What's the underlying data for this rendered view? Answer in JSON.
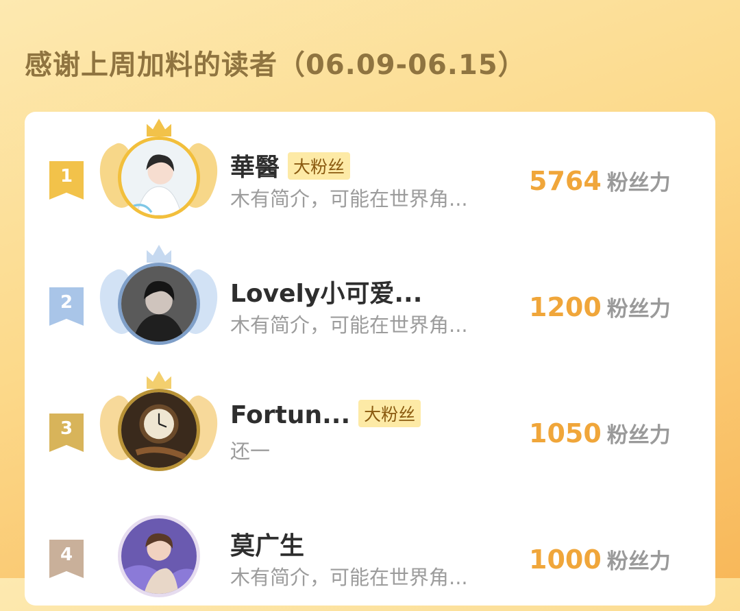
{
  "header": {
    "title": "感谢上周加料的读者（06.09-06.15）"
  },
  "readers": [
    {
      "rank": "1",
      "name": "華醫",
      "badge": "大粉丝",
      "desc": "木有简介，可能在世界角...",
      "score": "5764",
      "unit": "粉丝力",
      "color": "#f2c24a",
      "avatar": "anime-boy-white-icon"
    },
    {
      "rank": "2",
      "name": "Lovely小可爱...",
      "badge": "",
      "desc": "木有简介，可能在世界角...",
      "score": "1200",
      "unit": "粉丝力",
      "color": "#a9c5e8",
      "avatar": "dark-hair-boy-icon"
    },
    {
      "rank": "3",
      "name": "Fortun...",
      "badge": "大粉丝",
      "desc": "还一",
      "score": "1050",
      "unit": "粉丝力",
      "color": "#d8b45a",
      "avatar": "clock-icon"
    },
    {
      "rank": "4",
      "name": "莫广生",
      "badge": "",
      "desc": "木有简介，可能在世界角...",
      "score": "1000",
      "unit": "粉丝力",
      "color": "#c9b09a",
      "avatar": "anime-fighter-icon"
    }
  ]
}
